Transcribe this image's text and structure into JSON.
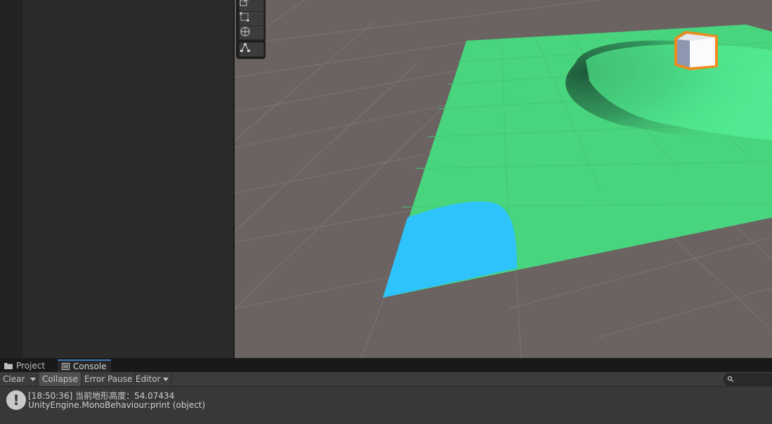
{
  "tabs": [
    {
      "label": "Project",
      "icon": "folder-icon",
      "active": false
    },
    {
      "label": "Console",
      "icon": "console-icon",
      "active": true
    }
  ],
  "console_toolbar": {
    "clear_label": "Clear",
    "collapse_label": "Collapse",
    "error_pause_label": "Error Pause",
    "editor_label": "Editor"
  },
  "search": {
    "placeholder": ""
  },
  "log": {
    "line1": "[18:50:36] 当前地形高度：54.07434",
    "line2": "UnityEngine.MonoBehaviour:print (object)",
    "icon": "info-icon"
  },
  "colors": {
    "terrain": "#49d47e",
    "water": "#2ec3fb",
    "selection_outline": "#f08a1e",
    "scene_background": "#6a6361"
  }
}
